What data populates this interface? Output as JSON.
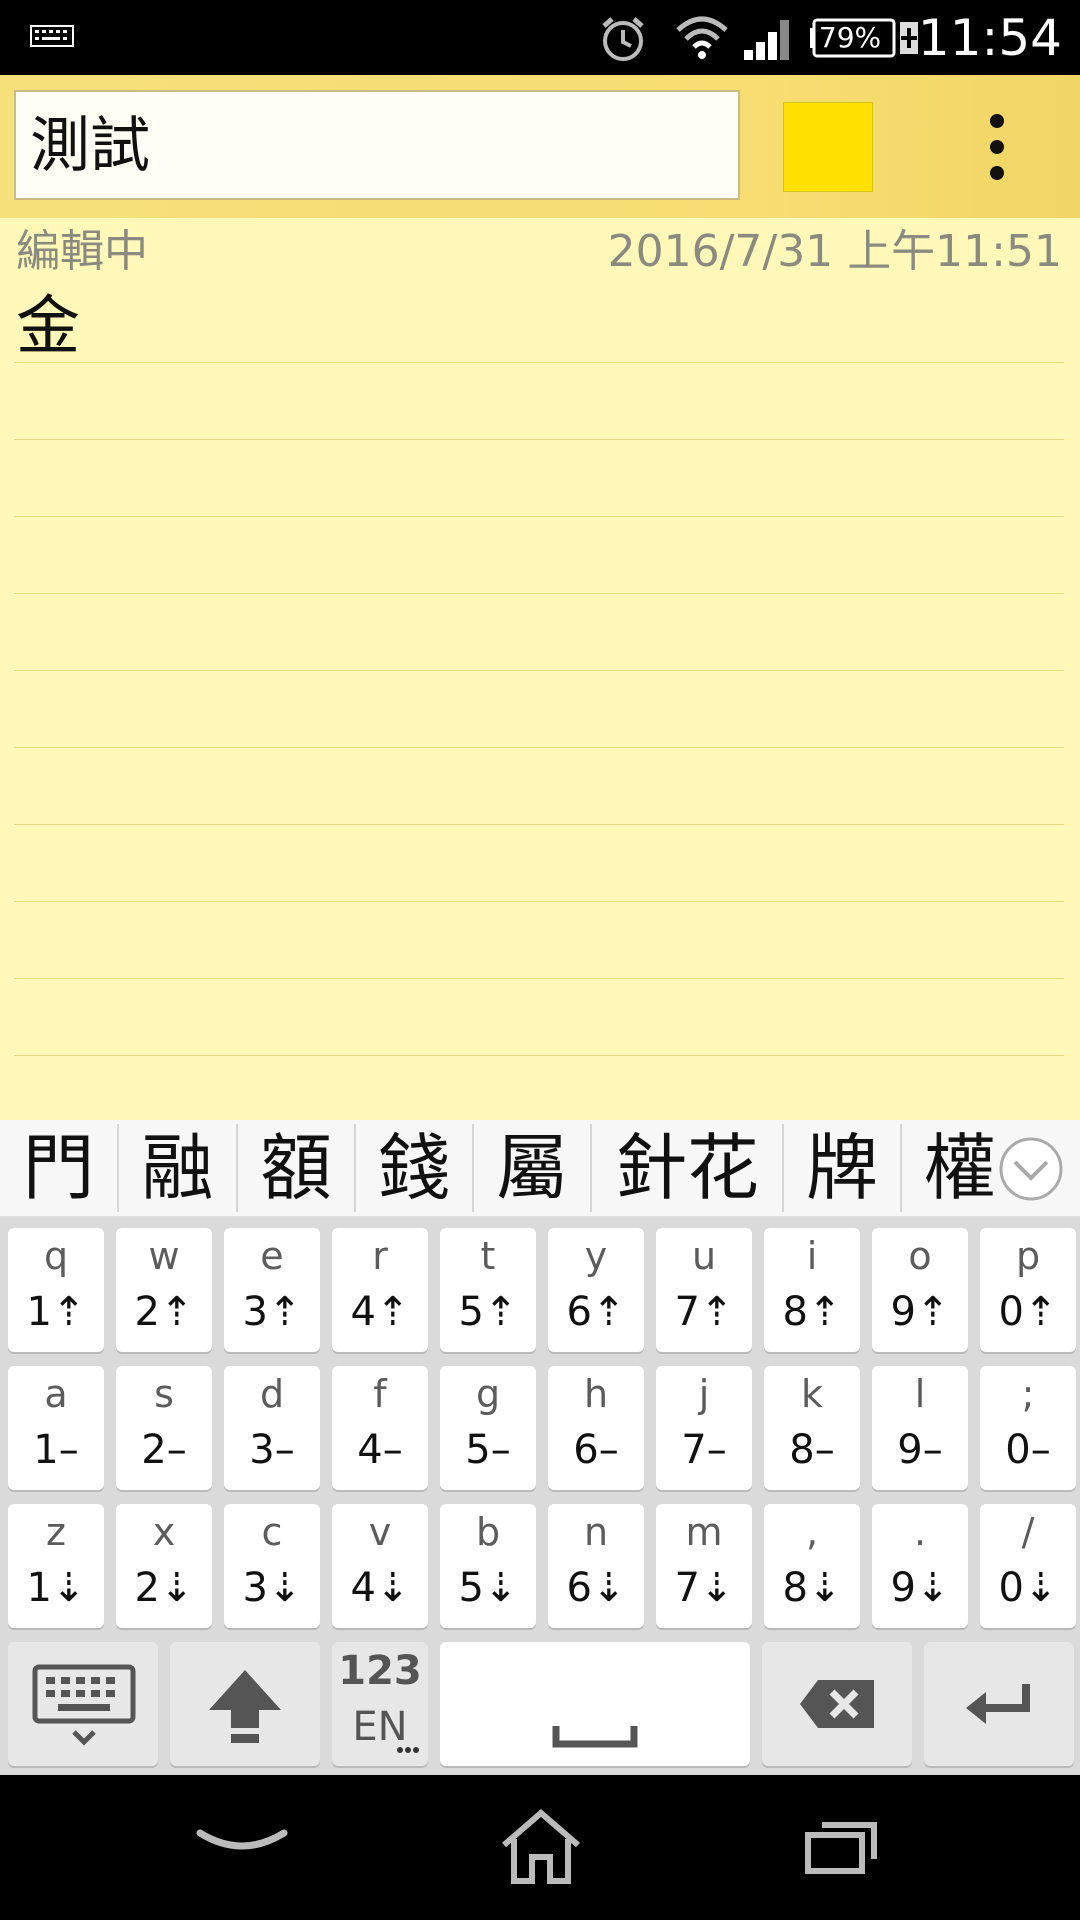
{
  "status_bar": {
    "battery": "79%",
    "time": "11:54"
  },
  "note": {
    "title": "測試",
    "swatch_color": "#ffe000",
    "status": "編輯中",
    "datetime": "2016/7/31 上午11:51",
    "body": "金"
  },
  "candidates": [
    "門",
    "融",
    "額",
    "錢",
    "屬",
    "針花",
    "牌",
    "權"
  ],
  "keyboard": {
    "row1": [
      {
        "main": "q",
        "sub": "1⇡"
      },
      {
        "main": "w",
        "sub": "2⇡"
      },
      {
        "main": "e",
        "sub": "3⇡"
      },
      {
        "main": "r",
        "sub": "4⇡"
      },
      {
        "main": "t",
        "sub": "5⇡"
      },
      {
        "main": "y",
        "sub": "6⇡"
      },
      {
        "main": "u",
        "sub": "7⇡"
      },
      {
        "main": "i",
        "sub": "8⇡"
      },
      {
        "main": "o",
        "sub": "9⇡"
      },
      {
        "main": "p",
        "sub": "0⇡"
      }
    ],
    "row2": [
      {
        "main": "a",
        "sub": "1–"
      },
      {
        "main": "s",
        "sub": "2–"
      },
      {
        "main": "d",
        "sub": "3–"
      },
      {
        "main": "f",
        "sub": "4–"
      },
      {
        "main": "g",
        "sub": "5–"
      },
      {
        "main": "h",
        "sub": "6–"
      },
      {
        "main": "j",
        "sub": "7–"
      },
      {
        "main": "k",
        "sub": "8–"
      },
      {
        "main": "l",
        "sub": "9–"
      },
      {
        "main": ";",
        "sub": "0–"
      }
    ],
    "row3": [
      {
        "main": "z",
        "sub": "1⇣"
      },
      {
        "main": "x",
        "sub": "2⇣"
      },
      {
        "main": "c",
        "sub": "3⇣"
      },
      {
        "main": "v",
        "sub": "4⇣"
      },
      {
        "main": "b",
        "sub": "5⇣"
      },
      {
        "main": "n",
        "sub": "6⇣"
      },
      {
        "main": "m",
        "sub": "7⇣"
      },
      {
        "main": ",",
        "sub": "8⇣"
      },
      {
        "main": ".",
        "sub": "9⇣"
      },
      {
        "main": "/",
        "sub": "0⇣"
      }
    ],
    "mode_top": "123",
    "mode_bottom": "EN",
    "icons": [
      "keyboard-hide-icon",
      "shift-icon",
      "space-icon",
      "backspace-icon",
      "enter-icon"
    ]
  },
  "navigation": {
    "icons": [
      "back-icon",
      "home-icon",
      "recents-icon"
    ]
  }
}
